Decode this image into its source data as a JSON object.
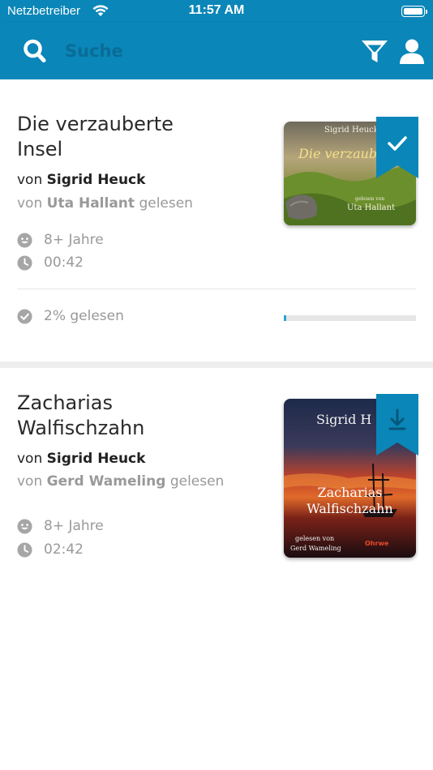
{
  "status_bar": {
    "carrier": "Netzbetreiber",
    "time": "11:57 AM"
  },
  "header": {
    "search_placeholder": "Suche",
    "search_icon": "search-icon",
    "filter_icon": "filter-icon",
    "user_icon": "user-icon",
    "background_color": "#0a86b8"
  },
  "books": [
    {
      "title_line1": "Die verzauberte",
      "title_line2": "Insel",
      "author_prefix": "von",
      "author": "Sigrid Heuck",
      "narrator_prefix": "von",
      "narrator": "Uta Hallant",
      "narrator_suffix": "gelesen",
      "age": "8+ Jahre",
      "duration": "00:42",
      "progress_text": "2% gelesen",
      "progress_fraction": 0.02,
      "ribbon_icon": "checkmark-icon",
      "cover": {
        "author": "Sigrid Heuck",
        "title": "Die verzauberte Insel",
        "reader_label": "gelesen von",
        "reader": "Uta Hallant"
      }
    },
    {
      "title_line1": "Zacharias",
      "title_line2": "Walfischzahn",
      "author_prefix": "von",
      "author": "Sigrid Heuck",
      "narrator_prefix": "von",
      "narrator": "Gerd Wameling",
      "narrator_suffix": "gelesen",
      "age": "8+ Jahre",
      "duration": "02:42",
      "ribbon_icon": "download-icon",
      "cover": {
        "author": "Sigrid H",
        "title_line1": "Zacharias",
        "title_line2": "Walfischzahn",
        "reader_label": "gelesen von",
        "reader": "Gerd Wameling",
        "publisher": "Ohrwe"
      }
    }
  ]
}
